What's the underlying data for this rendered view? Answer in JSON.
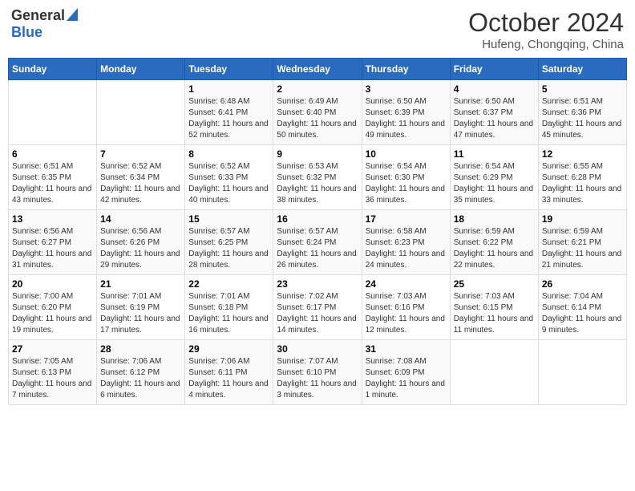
{
  "header": {
    "logo_general": "General",
    "logo_blue": "Blue",
    "main_title": "October 2024",
    "subtitle": "Hufeng, Chongqing, China"
  },
  "days_of_week": [
    "Sunday",
    "Monday",
    "Tuesday",
    "Wednesday",
    "Thursday",
    "Friday",
    "Saturday"
  ],
  "weeks": [
    [
      {
        "day": "",
        "info": ""
      },
      {
        "day": "",
        "info": ""
      },
      {
        "day": "1",
        "info": "Sunrise: 6:48 AM\nSunset: 6:41 PM\nDaylight: 11 hours and 52 minutes."
      },
      {
        "day": "2",
        "info": "Sunrise: 6:49 AM\nSunset: 6:40 PM\nDaylight: 11 hours and 50 minutes."
      },
      {
        "day": "3",
        "info": "Sunrise: 6:50 AM\nSunset: 6:39 PM\nDaylight: 11 hours and 49 minutes."
      },
      {
        "day": "4",
        "info": "Sunrise: 6:50 AM\nSunset: 6:37 PM\nDaylight: 11 hours and 47 minutes."
      },
      {
        "day": "5",
        "info": "Sunrise: 6:51 AM\nSunset: 6:36 PM\nDaylight: 11 hours and 45 minutes."
      }
    ],
    [
      {
        "day": "6",
        "info": "Sunrise: 6:51 AM\nSunset: 6:35 PM\nDaylight: 11 hours and 43 minutes."
      },
      {
        "day": "7",
        "info": "Sunrise: 6:52 AM\nSunset: 6:34 PM\nDaylight: 11 hours and 42 minutes."
      },
      {
        "day": "8",
        "info": "Sunrise: 6:52 AM\nSunset: 6:33 PM\nDaylight: 11 hours and 40 minutes."
      },
      {
        "day": "9",
        "info": "Sunrise: 6:53 AM\nSunset: 6:32 PM\nDaylight: 11 hours and 38 minutes."
      },
      {
        "day": "10",
        "info": "Sunrise: 6:54 AM\nSunset: 6:30 PM\nDaylight: 11 hours and 36 minutes."
      },
      {
        "day": "11",
        "info": "Sunrise: 6:54 AM\nSunset: 6:29 PM\nDaylight: 11 hours and 35 minutes."
      },
      {
        "day": "12",
        "info": "Sunrise: 6:55 AM\nSunset: 6:28 PM\nDaylight: 11 hours and 33 minutes."
      }
    ],
    [
      {
        "day": "13",
        "info": "Sunrise: 6:56 AM\nSunset: 6:27 PM\nDaylight: 11 hours and 31 minutes."
      },
      {
        "day": "14",
        "info": "Sunrise: 6:56 AM\nSunset: 6:26 PM\nDaylight: 11 hours and 29 minutes."
      },
      {
        "day": "15",
        "info": "Sunrise: 6:57 AM\nSunset: 6:25 PM\nDaylight: 11 hours and 28 minutes."
      },
      {
        "day": "16",
        "info": "Sunrise: 6:57 AM\nSunset: 6:24 PM\nDaylight: 11 hours and 26 minutes."
      },
      {
        "day": "17",
        "info": "Sunrise: 6:58 AM\nSunset: 6:23 PM\nDaylight: 11 hours and 24 minutes."
      },
      {
        "day": "18",
        "info": "Sunrise: 6:59 AM\nSunset: 6:22 PM\nDaylight: 11 hours and 22 minutes."
      },
      {
        "day": "19",
        "info": "Sunrise: 6:59 AM\nSunset: 6:21 PM\nDaylight: 11 hours and 21 minutes."
      }
    ],
    [
      {
        "day": "20",
        "info": "Sunrise: 7:00 AM\nSunset: 6:20 PM\nDaylight: 11 hours and 19 minutes."
      },
      {
        "day": "21",
        "info": "Sunrise: 7:01 AM\nSunset: 6:19 PM\nDaylight: 11 hours and 17 minutes."
      },
      {
        "day": "22",
        "info": "Sunrise: 7:01 AM\nSunset: 6:18 PM\nDaylight: 11 hours and 16 minutes."
      },
      {
        "day": "23",
        "info": "Sunrise: 7:02 AM\nSunset: 6:17 PM\nDaylight: 11 hours and 14 minutes."
      },
      {
        "day": "24",
        "info": "Sunrise: 7:03 AM\nSunset: 6:16 PM\nDaylight: 11 hours and 12 minutes."
      },
      {
        "day": "25",
        "info": "Sunrise: 7:03 AM\nSunset: 6:15 PM\nDaylight: 11 hours and 11 minutes."
      },
      {
        "day": "26",
        "info": "Sunrise: 7:04 AM\nSunset: 6:14 PM\nDaylight: 11 hours and 9 minutes."
      }
    ],
    [
      {
        "day": "27",
        "info": "Sunrise: 7:05 AM\nSunset: 6:13 PM\nDaylight: 11 hours and 7 minutes."
      },
      {
        "day": "28",
        "info": "Sunrise: 7:06 AM\nSunset: 6:12 PM\nDaylight: 11 hours and 6 minutes."
      },
      {
        "day": "29",
        "info": "Sunrise: 7:06 AM\nSunset: 6:11 PM\nDaylight: 11 hours and 4 minutes."
      },
      {
        "day": "30",
        "info": "Sunrise: 7:07 AM\nSunset: 6:10 PM\nDaylight: 11 hours and 3 minutes."
      },
      {
        "day": "31",
        "info": "Sunrise: 7:08 AM\nSunset: 6:09 PM\nDaylight: 11 hours and 1 minute."
      },
      {
        "day": "",
        "info": ""
      },
      {
        "day": "",
        "info": ""
      }
    ]
  ]
}
